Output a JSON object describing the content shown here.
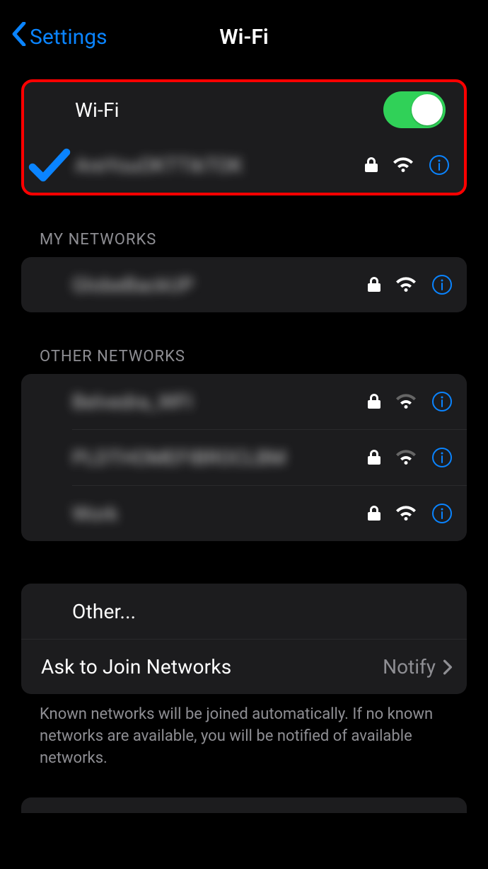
{
  "nav": {
    "back_label": "Settings",
    "title": "Wi-Fi"
  },
  "wifi": {
    "toggle_label": "Wi-Fi",
    "toggle_on": true,
    "connected_name": "AreYouOKTTikTOK"
  },
  "sections": {
    "my_networks_header": "MY NETWORKS",
    "my_networks": [
      {
        "name": "GlobeBackUP"
      }
    ],
    "other_networks_header": "OTHER NETWORKS",
    "other_networks": [
      {
        "name": "Belvedra_WFI"
      },
      {
        "name": "PLDTHOMEFIBROCLBM"
      },
      {
        "name": "Work"
      }
    ]
  },
  "other_item_label": "Other...",
  "ask_to_join": {
    "label": "Ask to Join Networks",
    "value": "Notify"
  },
  "footer_note": "Known networks will be joined automatically. If no known networks are available, you will be notified of available networks."
}
